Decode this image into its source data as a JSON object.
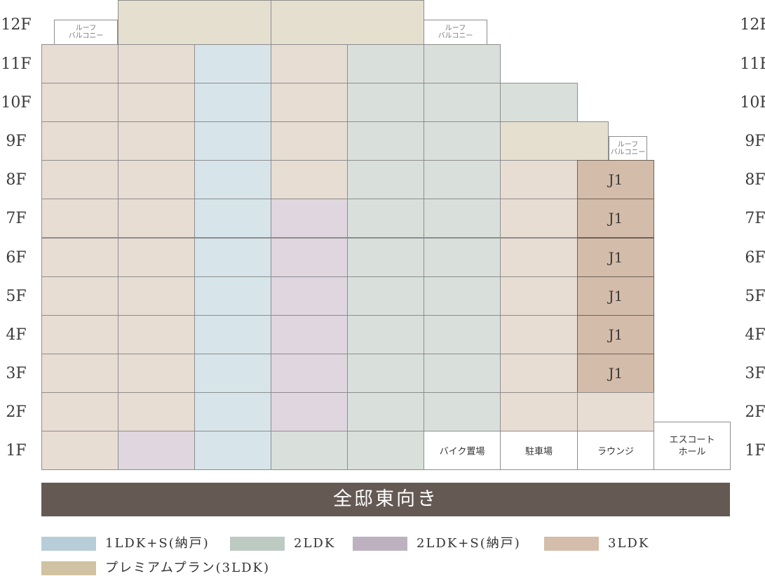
{
  "colors": {
    "3LDK": "#e8ddd3",
    "1LDK+S": "#d7e5ea",
    "2LDK": "#d9e0dc",
    "2LDK+S": "#dfd6df",
    "premium": "#e5dfd0",
    "J1": "#d4bcaa",
    "white": "#ffffff",
    "banner": "#645953"
  },
  "floors": [
    "12F",
    "11F",
    "10F",
    "9F",
    "8F",
    "7F",
    "6F",
    "5F",
    "4F",
    "3F",
    "2F",
    "1F"
  ],
  "cells": [
    {
      "id": "r12-c2",
      "type": "premium"
    },
    {
      "id": "r12-c3",
      "type": "premium"
    },
    {
      "id": "roof-12-left",
      "type": "roof",
      "label": "ルーフ\nバルコニー"
    },
    {
      "id": "roof-12-right",
      "type": "roof",
      "label": "ルーフ\nバルコニー"
    },
    {
      "id": "r11-c1",
      "type": "3LDK"
    },
    {
      "id": "r11-c2",
      "type": "3LDK"
    },
    {
      "id": "r11-c3",
      "type": "1LDK+S"
    },
    {
      "id": "r11-c4",
      "type": "3LDK"
    },
    {
      "id": "r11-c5",
      "type": "2LDK"
    },
    {
      "id": "r11-c6",
      "type": "2LDK"
    },
    {
      "id": "r10-c1",
      "type": "3LDK"
    },
    {
      "id": "r10-c2",
      "type": "3LDK"
    },
    {
      "id": "r10-c3",
      "type": "1LDK+S"
    },
    {
      "id": "r10-c4",
      "type": "3LDK"
    },
    {
      "id": "r10-c5",
      "type": "2LDK"
    },
    {
      "id": "r10-c6",
      "type": "2LDK"
    },
    {
      "id": "r10-c7",
      "type": "2LDK"
    },
    {
      "id": "r9-c1",
      "type": "3LDK"
    },
    {
      "id": "r9-c2",
      "type": "3LDK"
    },
    {
      "id": "r9-c3",
      "type": "1LDK+S"
    },
    {
      "id": "r9-c4",
      "type": "3LDK"
    },
    {
      "id": "r9-c5",
      "type": "2LDK"
    },
    {
      "id": "r9-c6",
      "type": "2LDK"
    },
    {
      "id": "r9-c7",
      "type": "premium"
    },
    {
      "id": "roof-9",
      "type": "roof",
      "label": "ルーフ\nバルコニー"
    },
    {
      "id": "r8-c1",
      "type": "3LDK"
    },
    {
      "id": "r8-c2",
      "type": "3LDK"
    },
    {
      "id": "r8-c3",
      "type": "1LDK+S"
    },
    {
      "id": "r8-c4",
      "type": "3LDK"
    },
    {
      "id": "r8-c5",
      "type": "2LDK"
    },
    {
      "id": "r8-c6",
      "type": "2LDK"
    },
    {
      "id": "r8-c7",
      "type": "3LDK"
    },
    {
      "id": "r8-c8",
      "type": "J1",
      "label": "J1"
    },
    {
      "id": "r7-c1",
      "type": "3LDK"
    },
    {
      "id": "r7-c2",
      "type": "3LDK"
    },
    {
      "id": "r7-c3",
      "type": "1LDK+S"
    },
    {
      "id": "r7-c4",
      "type": "2LDK+S"
    },
    {
      "id": "r7-c5",
      "type": "2LDK"
    },
    {
      "id": "r7-c6",
      "type": "2LDK"
    },
    {
      "id": "r7-c7",
      "type": "3LDK"
    },
    {
      "id": "r7-c8",
      "type": "J1",
      "label": "J1"
    },
    {
      "id": "r6-c1",
      "type": "3LDK"
    },
    {
      "id": "r6-c2",
      "type": "3LDK"
    },
    {
      "id": "r6-c3",
      "type": "1LDK+S"
    },
    {
      "id": "r6-c4",
      "type": "2LDK+S"
    },
    {
      "id": "r6-c5",
      "type": "2LDK"
    },
    {
      "id": "r6-c6",
      "type": "2LDK"
    },
    {
      "id": "r6-c7",
      "type": "3LDK"
    },
    {
      "id": "r6-c8",
      "type": "J1",
      "label": "J1"
    },
    {
      "id": "r5-c1",
      "type": "3LDK"
    },
    {
      "id": "r5-c2",
      "type": "3LDK"
    },
    {
      "id": "r5-c3",
      "type": "1LDK+S"
    },
    {
      "id": "r5-c4",
      "type": "2LDK+S"
    },
    {
      "id": "r5-c5",
      "type": "2LDK"
    },
    {
      "id": "r5-c6",
      "type": "2LDK"
    },
    {
      "id": "r5-c7",
      "type": "3LDK"
    },
    {
      "id": "r5-c8",
      "type": "J1",
      "label": "J1"
    },
    {
      "id": "r4-c1",
      "type": "3LDK"
    },
    {
      "id": "r4-c2",
      "type": "3LDK"
    },
    {
      "id": "r4-c3",
      "type": "1LDK+S"
    },
    {
      "id": "r4-c4",
      "type": "2LDK+S"
    },
    {
      "id": "r4-c5",
      "type": "2LDK"
    },
    {
      "id": "r4-c6",
      "type": "2LDK"
    },
    {
      "id": "r4-c7",
      "type": "3LDK"
    },
    {
      "id": "r4-c8",
      "type": "J1",
      "label": "J1"
    },
    {
      "id": "r3-c1",
      "type": "3LDK"
    },
    {
      "id": "r3-c2",
      "type": "3LDK"
    },
    {
      "id": "r3-c3",
      "type": "1LDK+S"
    },
    {
      "id": "r3-c4",
      "type": "2LDK+S"
    },
    {
      "id": "r3-c5",
      "type": "2LDK"
    },
    {
      "id": "r3-c6",
      "type": "2LDK"
    },
    {
      "id": "r3-c7",
      "type": "3LDK"
    },
    {
      "id": "r3-c8",
      "type": "J1",
      "label": "J1"
    },
    {
      "id": "r2-c1",
      "type": "3LDK"
    },
    {
      "id": "r2-c2",
      "type": "3LDK"
    },
    {
      "id": "r2-c3",
      "type": "1LDK+S"
    },
    {
      "id": "r2-c4",
      "type": "2LDK+S"
    },
    {
      "id": "r2-c5",
      "type": "2LDK"
    },
    {
      "id": "r2-c6",
      "type": "2LDK"
    },
    {
      "id": "r2-c7",
      "type": "3LDK"
    },
    {
      "id": "r2-c8",
      "type": "3LDK"
    },
    {
      "id": "escort-hall",
      "type": "white",
      "label": "エスコート\nホール"
    },
    {
      "id": "r1-c1",
      "type": "3LDK"
    },
    {
      "id": "r1-c2",
      "type": "2LDK+S"
    },
    {
      "id": "r1-c3",
      "type": "1LDK+S"
    },
    {
      "id": "r1-c4",
      "type": "2LDK"
    },
    {
      "id": "r1-c5",
      "type": "2LDK"
    },
    {
      "id": "bike-parking",
      "type": "white",
      "label": "バイク置場"
    },
    {
      "id": "car-parking",
      "type": "white",
      "label": "駐車場"
    },
    {
      "id": "lounge",
      "type": "white",
      "label": "ラウンジ"
    }
  ],
  "banner": {
    "text": "全邸東向き"
  },
  "legend": [
    {
      "label": "1LDK+S(納戸)",
      "color": "#b7ced9"
    },
    {
      "label": "2LDK",
      "color": "#bccac2"
    },
    {
      "label": "2LDK+S(納戸)",
      "color": "#bdb1c0"
    },
    {
      "label": "3LDK",
      "color": "#d5bdab"
    },
    {
      "label": "プレミアムプラン(3LDK)",
      "color": "#cfc3a3"
    }
  ]
}
